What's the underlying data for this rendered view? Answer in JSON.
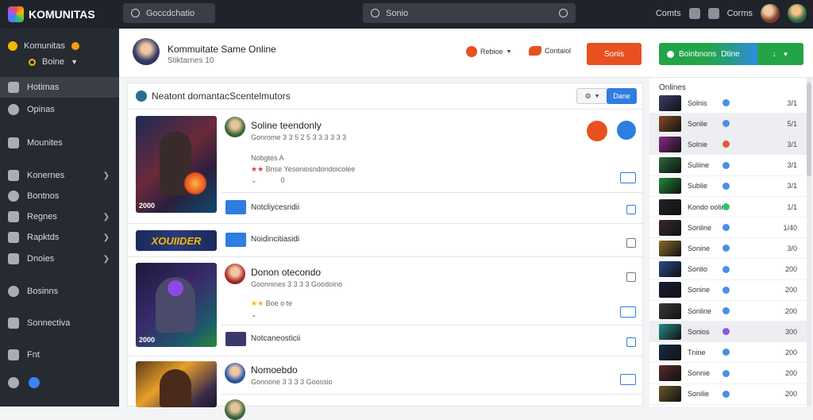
{
  "app": {
    "name": "KOMUNITAS"
  },
  "topbar": {
    "search_left": "Goccdchatio",
    "search_main": "Sonio",
    "right_label1": "Comts",
    "right_label2": "Corms"
  },
  "sidebar": {
    "user_name": "Komunitas",
    "user_status": "Boine",
    "items": [
      {
        "label": "Hotimas",
        "active": true,
        "chevron": false
      },
      {
        "label": "Opinas",
        "active": false,
        "chevron": false
      },
      {
        "label": "Mounites",
        "active": false,
        "chevron": false
      },
      {
        "label": "Konernes",
        "active": false,
        "chevron": true
      },
      {
        "label": "Bontnos",
        "active": false,
        "chevron": false
      },
      {
        "label": "Regnes",
        "active": false,
        "chevron": true
      },
      {
        "label": "Rapktds",
        "active": false,
        "chevron": true
      },
      {
        "label": "Dnoies",
        "active": false,
        "chevron": true
      },
      {
        "label": "Bosinns",
        "active": false,
        "chevron": false
      },
      {
        "label": "Sonnectiva",
        "active": false,
        "chevron": false
      },
      {
        "label": "Fnt",
        "active": false,
        "chevron": false
      },
      {
        "label": "",
        "active": false,
        "chevron": false
      }
    ]
  },
  "header": {
    "title": "Kommuitate Same Online",
    "subtitle": "Stiktarnes 10",
    "btn1": "Rebioe",
    "btn2": "Contaiol",
    "btn3": "Sonis",
    "btn4_main": "Boinbnons",
    "btn4_accent": "Dtine"
  },
  "feed": {
    "header": "Neatont domantacScentelmutors",
    "select_label": "",
    "blue_btn": "Dane",
    "posts": [
      {
        "thumb_caption": "2000",
        "name": "Soline teendonly",
        "meta": "Gonrome 3 3 5 2 5 3 3 3 3 3 3",
        "stars": "★★",
        "stars_text": "Bnse Yesoniosndondoicolee",
        "sub": "Nobgtes A",
        "count": "0",
        "row_label": "Notcliycesridii"
      },
      {
        "thumb_caption": "XOUIIDER",
        "name": "",
        "row_label": "Noidincitiasidi"
      },
      {
        "thumb_caption": "2000",
        "name": "Donon otecondo",
        "meta": "Goonnines 3 3 3 3 Goodoino",
        "stars": "★★",
        "stars_text": "Boe o te",
        "row_label": "Notcaneosticii"
      },
      {
        "thumb_caption": "",
        "name": "Nomoebdo",
        "meta": "Gonnone 3 3 3 3 Goossio"
      }
    ]
  },
  "right_panel": {
    "title": "Onlines",
    "rows": [
      {
        "name": "Solnis",
        "status": "#4a90e2",
        "num": "3/1",
        "hl": false,
        "color": "#3a3f6a"
      },
      {
        "name": "Sonlie",
        "status": "#4a90e2",
        "num": "5/1",
        "hl": true,
        "color": "#8a4a2a"
      },
      {
        "name": "Solnie",
        "status": "#e05a3b",
        "num": "3/1",
        "hl": true,
        "color": "#8a2a8a"
      },
      {
        "name": "Suliine",
        "status": "#4a90e2",
        "num": "3/1",
        "hl": false,
        "color": "#2a6a3a"
      },
      {
        "name": "Sublie",
        "status": "#4a90e2",
        "num": "3/1",
        "hl": false,
        "color": "#1f8a3a"
      },
      {
        "name": "Kondo ooline",
        "status": "#34c36b",
        "num": "1/1",
        "hl": false,
        "color": "#222"
      },
      {
        "name": "Sonline",
        "status": "#4a90e2",
        "num": "1/40",
        "hl": false,
        "color": "#3a2a2a"
      },
      {
        "name": "Sonine",
        "status": "#4a90e2",
        "num": "3/0",
        "hl": false,
        "color": "#8a6a2a"
      },
      {
        "name": "Sonlio",
        "status": "#4a90e2",
        "num": "200",
        "hl": false,
        "color": "#2a4a8a"
      },
      {
        "name": "Sonine",
        "status": "#4a90e2",
        "num": "200",
        "hl": false,
        "color": "#1a1a3a"
      },
      {
        "name": "Sonline",
        "status": "#4a90e2",
        "num": "200",
        "hl": false,
        "color": "#3a3a3a"
      },
      {
        "name": "Sonios",
        "status": "#8a5ae2",
        "num": "300",
        "hl": true,
        "color": "#2a8a8a"
      },
      {
        "name": "Tnine",
        "status": "#4a90e2",
        "num": "200",
        "hl": false,
        "color": "#1a2a4a"
      },
      {
        "name": "Sonnie",
        "status": "#4a90e2",
        "num": "200",
        "hl": false,
        "color": "#5a2a2a"
      },
      {
        "name": "Sonilie",
        "status": "#4a90e2",
        "num": "200",
        "hl": false,
        "color": "#6a5a2a"
      }
    ]
  }
}
